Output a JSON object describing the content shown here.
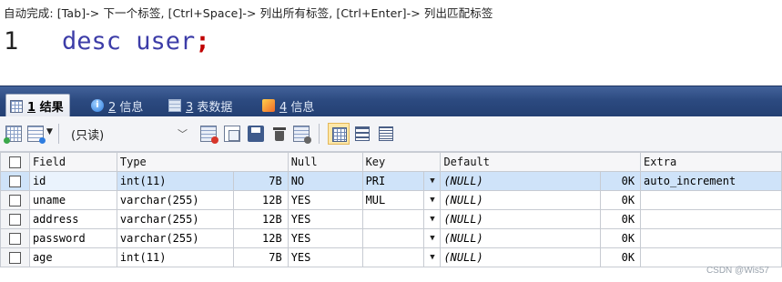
{
  "editor": {
    "hint": "自动完成: [Tab]-> 下一个标签, [Ctrl+Space]-> 列出所有标签, [Ctrl+Enter]-> 列出匹配标签",
    "line_number": "1",
    "code": "desc user",
    "semicolon": ";"
  },
  "tabs": [
    {
      "num": "1",
      "label": "结果",
      "icon": "result-grid-icon"
    },
    {
      "num": "2",
      "label": "信息",
      "icon": "info-icon"
    },
    {
      "num": "3",
      "label": "表数据",
      "icon": "table-data-icon"
    },
    {
      "num": "4",
      "label": "信息",
      "icon": "message-icon"
    }
  ],
  "toolbar": {
    "mode_select": "(只读)",
    "icons": [
      "add-row-icon",
      "dropdown-icon",
      "export-icon",
      "copy-icon",
      "save-icon",
      "delete-icon",
      "discard-icon",
      "grid-view-icon",
      "form-view-icon",
      "text-view-icon"
    ]
  },
  "grid": {
    "columns": [
      "Field",
      "Type",
      "Null",
      "Key",
      "Default",
      "Extra"
    ],
    "rows": [
      {
        "field": "id",
        "type": "int(11)",
        "type_size": "7B",
        "null": "NO",
        "key": "PRI",
        "default": "(NULL)",
        "default_size": "0K",
        "extra": "auto_increment"
      },
      {
        "field": "uname",
        "type": "varchar(255)",
        "type_size": "12B",
        "null": "YES",
        "key": "MUL",
        "default": "(NULL)",
        "default_size": "0K",
        "extra": ""
      },
      {
        "field": "address",
        "type": "varchar(255)",
        "type_size": "12B",
        "null": "YES",
        "key": "",
        "default": "(NULL)",
        "default_size": "0K",
        "extra": ""
      },
      {
        "field": "password",
        "type": "varchar(255)",
        "type_size": "12B",
        "null": "YES",
        "key": "",
        "default": "(NULL)",
        "default_size": "0K",
        "extra": ""
      },
      {
        "field": "age",
        "type": "int(11)",
        "type_size": "7B",
        "null": "YES",
        "key": "",
        "default": "(NULL)",
        "default_size": "0K",
        "extra": ""
      }
    ]
  },
  "watermark": "CSDN @Wis57",
  "colors": {
    "tabbar": "#2c4a80",
    "selected_row": "#cfe3f9",
    "keyword": "#3d3da8",
    "semicolon": "#c00000"
  }
}
